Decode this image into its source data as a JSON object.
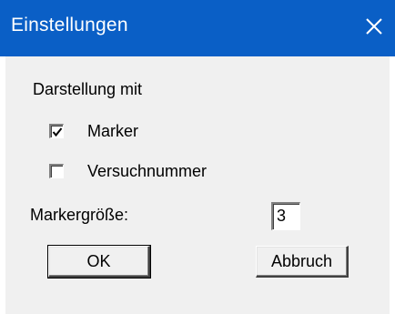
{
  "window": {
    "title": "Einstellungen",
    "close_icon": "close-icon",
    "titlebar_color": "#0a5fc6"
  },
  "dialog": {
    "group_label": "Darstellung mit",
    "marker_checkbox": {
      "label": "Marker",
      "checked": true
    },
    "testnumber_checkbox": {
      "label": "Versuchnummer",
      "checked": false
    },
    "marker_size_label": "Markergröße:",
    "marker_size_value": "3",
    "ok_label": "OK",
    "cancel_label": "Abbruch"
  }
}
